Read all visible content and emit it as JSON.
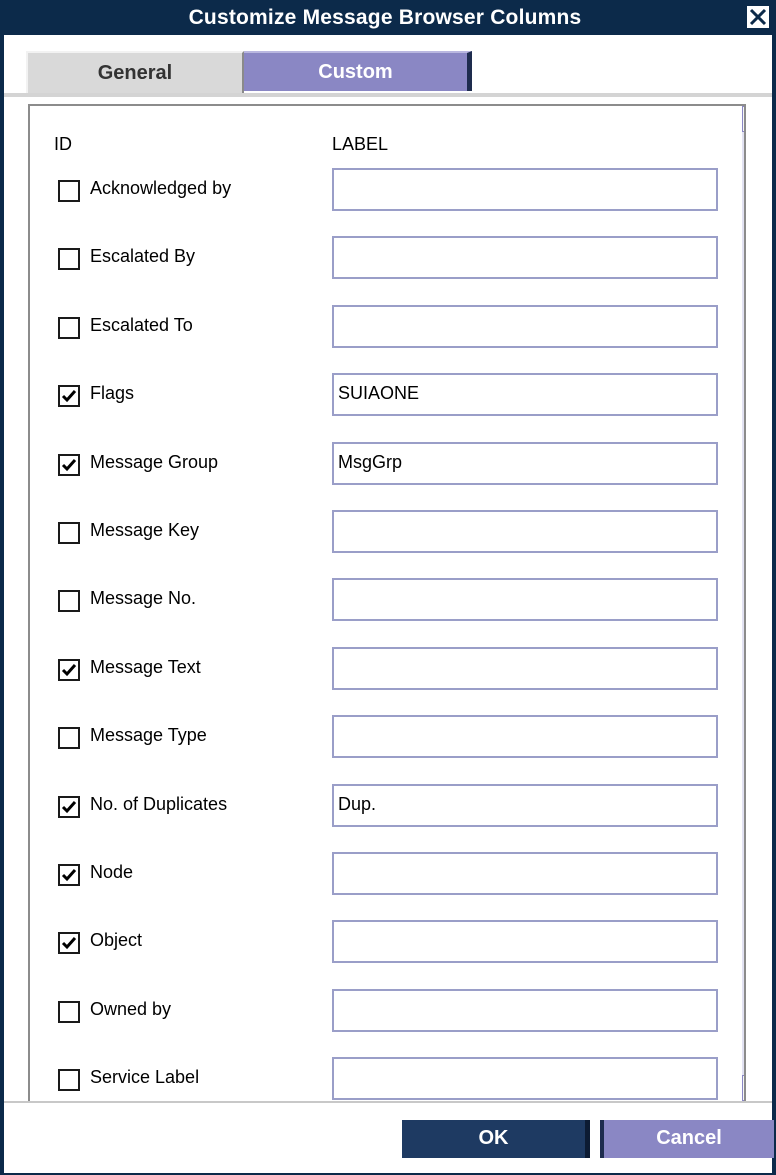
{
  "window": {
    "title": "Customize Message Browser Columns",
    "close_glyph": "X"
  },
  "tabs": [
    {
      "label": "General",
      "active": true
    },
    {
      "label": "Custom",
      "active": false
    }
  ],
  "headers": {
    "id": "ID",
    "label": "LABEL"
  },
  "rows": [
    {
      "id": "Acknowledged by",
      "checked": false,
      "label_value": ""
    },
    {
      "id": "Escalated By",
      "checked": false,
      "label_value": ""
    },
    {
      "id": "Escalated To",
      "checked": false,
      "label_value": ""
    },
    {
      "id": "Flags",
      "checked": true,
      "label_value": "SUIAONE"
    },
    {
      "id": "Message Group",
      "checked": true,
      "label_value": "MsgGrp"
    },
    {
      "id": "Message Key",
      "checked": false,
      "label_value": ""
    },
    {
      "id": "Message No.",
      "checked": false,
      "label_value": ""
    },
    {
      "id": "Message Text",
      "checked": true,
      "label_value": ""
    },
    {
      "id": "Message Type",
      "checked": false,
      "label_value": ""
    },
    {
      "id": "No. of Duplicates",
      "checked": true,
      "label_value": "Dup."
    },
    {
      "id": "Node",
      "checked": true,
      "label_value": ""
    },
    {
      "id": "Object",
      "checked": true,
      "label_value": ""
    },
    {
      "id": "Owned by",
      "checked": false,
      "label_value": ""
    },
    {
      "id": "Service Label",
      "checked": false,
      "label_value": ""
    }
  ],
  "buttons": {
    "ok": "OK",
    "cancel": "Cancel"
  },
  "colors": {
    "titlebar": "#0c2a4a",
    "tab_active": "#d9d9d9",
    "tab_inactive": "#8a87c4",
    "ok_button": "#1e3a62",
    "cancel_button": "#8a87c4",
    "scroll_thumb": "#8a87c4"
  }
}
